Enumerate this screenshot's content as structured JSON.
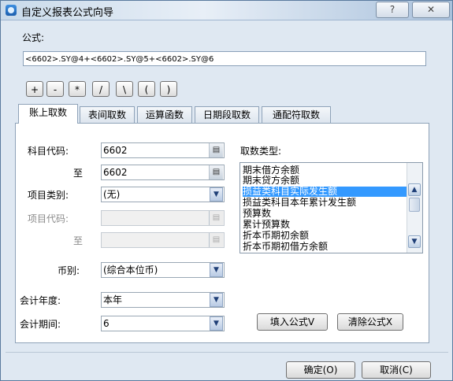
{
  "window": {
    "title": "自定义报表公式向导",
    "help_label": "?",
    "close_label": "✕"
  },
  "formula": {
    "label": "公式:",
    "value": "<6602>.SY@4+<6602>.SY@5+<6602>.SY@6"
  },
  "operators": [
    "+",
    "-",
    "*",
    "/",
    "\\",
    "(",
    ")"
  ],
  "tabs": [
    {
      "label": "账上取数",
      "active": true
    },
    {
      "label": "表间取数",
      "active": false
    },
    {
      "label": "运算函数",
      "active": false
    },
    {
      "label": "日期段取数",
      "active": false
    },
    {
      "label": "通配符取数",
      "active": false
    }
  ],
  "form": {
    "account_code_label": "科目代码:",
    "account_code_from": "6602",
    "to_label": "至",
    "account_code_to": "6602",
    "item_category_label": "项目类别:",
    "item_category_value": "(无)",
    "item_code_label": "项目代码:",
    "item_code_from": "",
    "item_to_label": "至",
    "item_code_to": "",
    "currency_label": "币别:",
    "currency_value": "(综合本位币)",
    "year_label": "会计年度:",
    "year_value": "本年",
    "period_label": "会计期间:",
    "period_value": "6"
  },
  "fetch_type": {
    "label": "取数类型:",
    "items": [
      "期末借方余额",
      "期末贷方余额",
      "损益类科目实际发生额",
      "损益类科目本年累计发生额",
      "预算数",
      "累计预算数",
      "折本币期初余额",
      "折本币期初借方余额"
    ],
    "selected_index": 2
  },
  "actions": {
    "fill_formula": "填入公式V",
    "clear_formula": "清除公式X",
    "ok": "确定(O)",
    "cancel": "取消(C)"
  },
  "icons": {
    "lookup": "lookup-icon",
    "dropdown": "chevron-down-icon"
  }
}
